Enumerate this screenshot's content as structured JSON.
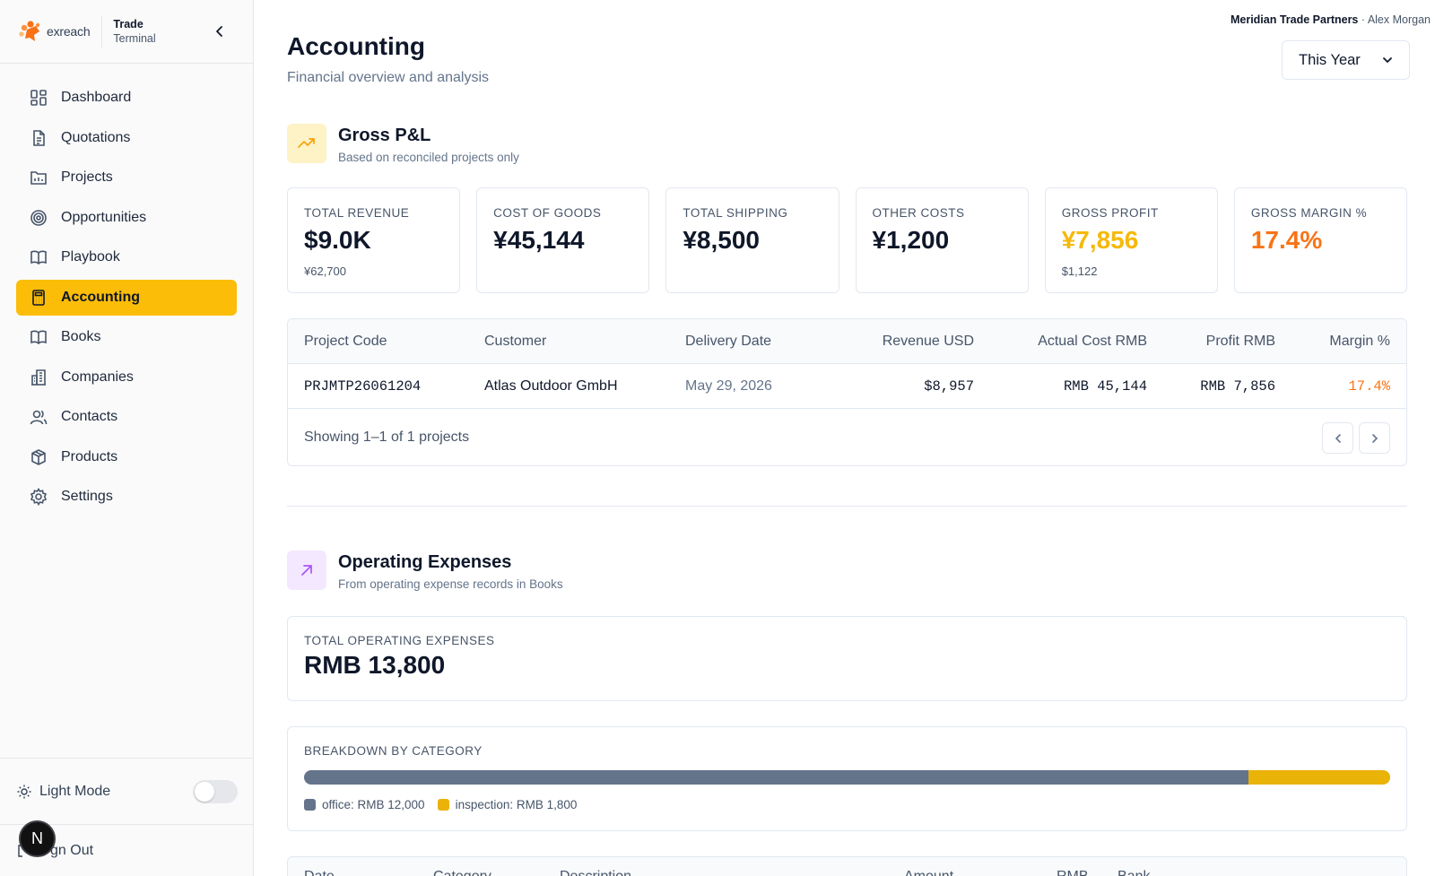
{
  "brand": {
    "logo_text": "exreach",
    "product_line1": "Trade",
    "product_line2": "Terminal"
  },
  "sidebar": {
    "items": [
      {
        "label": "Dashboard",
        "icon": "dashboard-icon",
        "active": false
      },
      {
        "label": "Quotations",
        "icon": "document-icon",
        "active": false
      },
      {
        "label": "Projects",
        "icon": "projects-icon",
        "active": false
      },
      {
        "label": "Opportunities",
        "icon": "target-icon",
        "active": false
      },
      {
        "label": "Playbook",
        "icon": "book-open-icon",
        "active": false
      },
      {
        "label": "Accounting",
        "icon": "calculator-icon",
        "active": true
      },
      {
        "label": "Books",
        "icon": "book-icon",
        "active": false
      },
      {
        "label": "Companies",
        "icon": "building-icon",
        "active": false
      },
      {
        "label": "Contacts",
        "icon": "users-icon",
        "active": false
      },
      {
        "label": "Products",
        "icon": "package-icon",
        "active": false
      },
      {
        "label": "Settings",
        "icon": "gear-icon",
        "active": false
      }
    ],
    "light_mode_label": "Light Mode",
    "sign_out_label": "gn Out",
    "avatar_letter": "N"
  },
  "header": {
    "org_name": "Meridian Trade Partners",
    "separator": " · ",
    "user_name": "Alex Morgan",
    "title": "Accounting",
    "subtitle": "Financial overview and analysis",
    "period": "This Year"
  },
  "gross_pl": {
    "title": "Gross P&L",
    "desc": "Based on reconciled projects only",
    "kpis": [
      {
        "label": "TOTAL REVENUE",
        "value": "$9.0K",
        "sub": "¥62,700",
        "color": "#0f172a"
      },
      {
        "label": "COST OF GOODS",
        "value": "¥45,144",
        "sub": "",
        "color": "#0f172a"
      },
      {
        "label": "TOTAL SHIPPING",
        "value": "¥8,500",
        "sub": "",
        "color": "#0f172a"
      },
      {
        "label": "OTHER COSTS",
        "value": "¥1,200",
        "sub": "",
        "color": "#0f172a"
      },
      {
        "label": "GROSS PROFIT",
        "value": "¥7,856",
        "sub": "$1,122",
        "color": "#f5b90b"
      },
      {
        "label": "GROSS MARGIN %",
        "value": "17.4%",
        "sub": "",
        "color": "#f97316"
      }
    ]
  },
  "projects_table": {
    "columns": [
      "Project Code",
      "Customer",
      "Delivery Date",
      "Revenue USD",
      "Actual Cost RMB",
      "Profit RMB",
      "Margin %"
    ],
    "rows": [
      [
        "PRJMTP26061204",
        "Atlas Outdoor GmbH",
        "May 29, 2026",
        "$8,957",
        "RMB 45,144",
        "RMB 7,856",
        "17.4%"
      ]
    ],
    "footer": "Showing 1–1 of 1 projects"
  },
  "opex": {
    "title": "Operating Expenses",
    "desc": "From operating expense records in Books",
    "total_label": "TOTAL OPERATING EXPENSES",
    "total_value": "RMB 13,800",
    "breakdown_label": "BREAKDOWN BY CATEGORY",
    "categories": [
      {
        "name": "office",
        "amount": 12000,
        "legend": "office: RMB 12,000",
        "color": "#64748b"
      },
      {
        "name": "inspection",
        "amount": 1800,
        "legend": "inspection: RMB 1,800",
        "color": "#eab308"
      }
    ],
    "table_columns": [
      "Date",
      "Category",
      "Description",
      "Amount",
      "RMB",
      "Bank"
    ]
  },
  "colors": {
    "accent": "#fbbd08",
    "amber": "#f5b90b",
    "orange": "#f97316"
  }
}
